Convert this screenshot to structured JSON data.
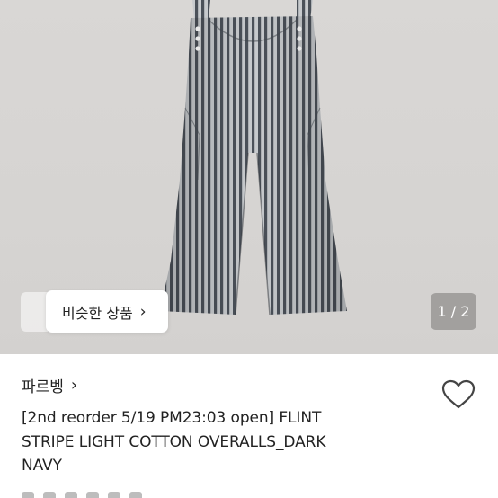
{
  "gallery": {
    "image_icon": "striped-overalls-photo",
    "similar_button_label": "비슷한 상품",
    "similar_button_icon": "chevron-right-icon",
    "page_counter": "1 / 2"
  },
  "product": {
    "shop_name": "파르벵",
    "shop_chevron_icon": "chevron-right-icon",
    "like_icon": "heart-outline-icon",
    "title_lines": [
      "[2nd reorder 5/19 PM23:03 open] FLINT",
      "STRIPE LIGHT COTTON OVERALLS_DARK",
      "NAVY"
    ]
  },
  "colors": {
    "photo_background": "#d7d5d3",
    "stripe_dark": "#4a5058",
    "stripe_light": "#c9cccf"
  }
}
